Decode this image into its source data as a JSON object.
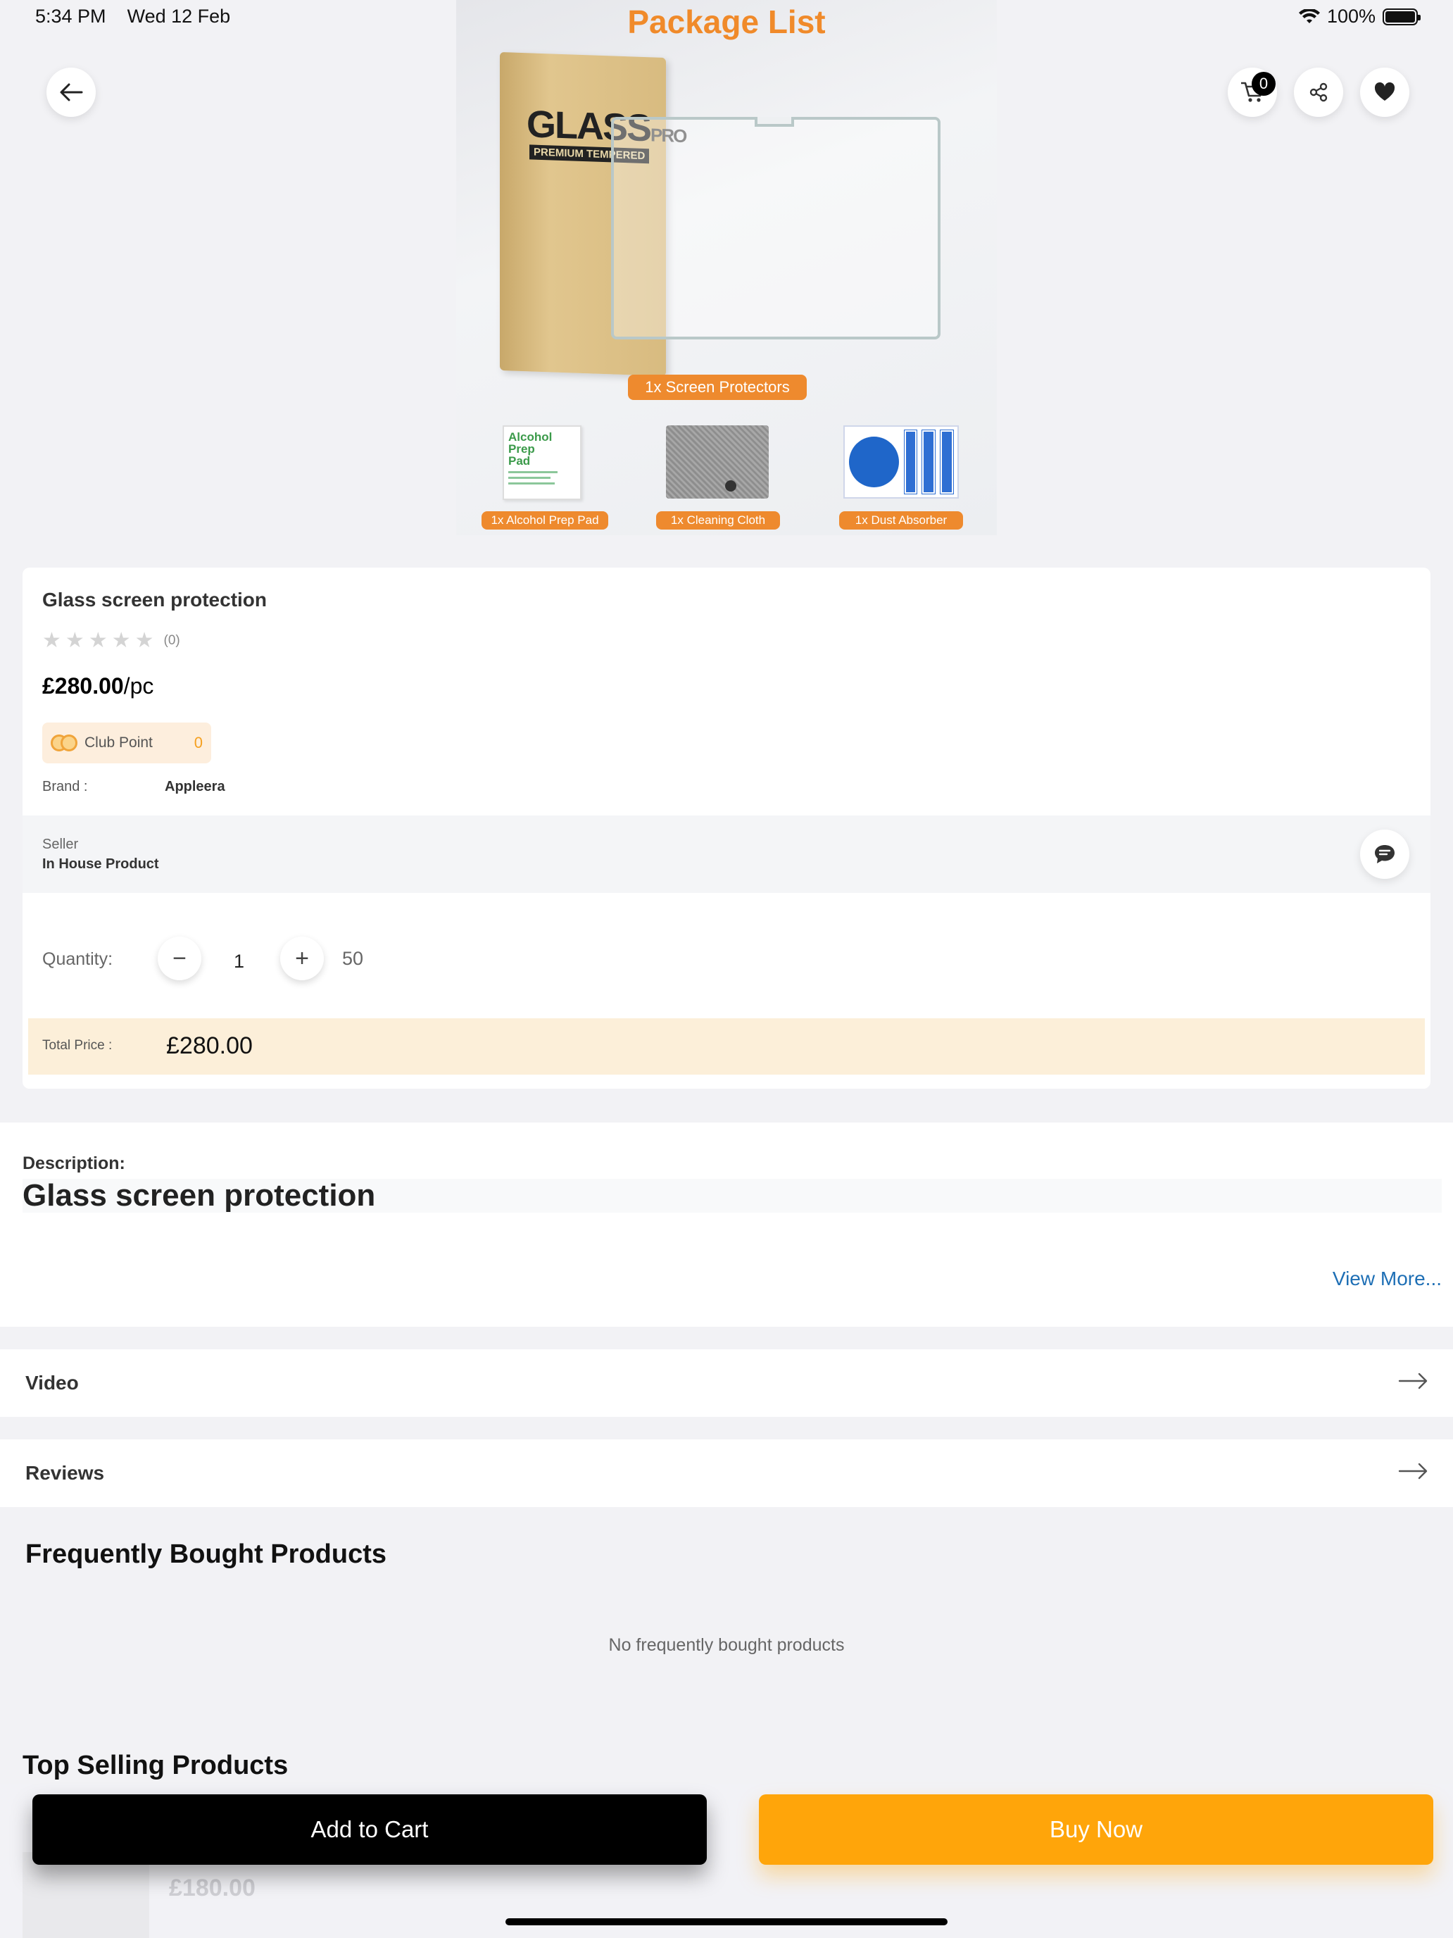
{
  "status_bar": {
    "time": "5:34 PM",
    "date": "Wed 12 Feb",
    "battery": "100%",
    "battery_level": 1.0
  },
  "hero": {
    "title": "Package List",
    "box_brand": "GLASS",
    "box_brand_suffix": "PRO",
    "box_subtitle": "PREMIUM TEMPERED",
    "main_caption": "1x Screen Protectors",
    "accessories": [
      {
        "caption": "1x Alcohol Prep Pad",
        "label": "Alcohol Prep Pad"
      },
      {
        "caption": "1x Cleaning Cloth"
      },
      {
        "caption": "1x Dust Absorber"
      }
    ]
  },
  "header": {
    "cart_count": "0",
    "icons": [
      "back-arrow-icon",
      "cart-icon",
      "share-icon",
      "heart-icon"
    ]
  },
  "product": {
    "title": "Glass screen protection",
    "rating": 0,
    "rating_count": "(0)",
    "price": "£280.00",
    "price_unit": "/pc",
    "club_point_label": "Club Point",
    "club_point_value": "0",
    "brand_label": "Brand :",
    "brand_value": "Appleera",
    "seller_label": "Seller",
    "seller_value": "In House Product",
    "quantity_label": "Quantity:",
    "quantity_value": "1",
    "stock": "50",
    "total_label": "Total Price :",
    "total_value": "£280.00"
  },
  "description": {
    "label": "Description:",
    "text": "Glass screen protection",
    "view_more": "View More..."
  },
  "sections": {
    "video": "Video",
    "reviews": "Reviews"
  },
  "frequently_bought": {
    "title": "Frequently Bought Products",
    "empty": "No frequently bought products"
  },
  "top_selling": {
    "title": "Top Selling Products",
    "first_price": "£180.00"
  },
  "actions": {
    "add_to_cart": "Add to Cart",
    "buy_now": "Buy Now"
  },
  "colors": {
    "accent_orange": "#ffa50a",
    "tag_orange": "#ee8a2e",
    "link_blue": "#1e6fb5",
    "total_band": "#fcefd9"
  }
}
